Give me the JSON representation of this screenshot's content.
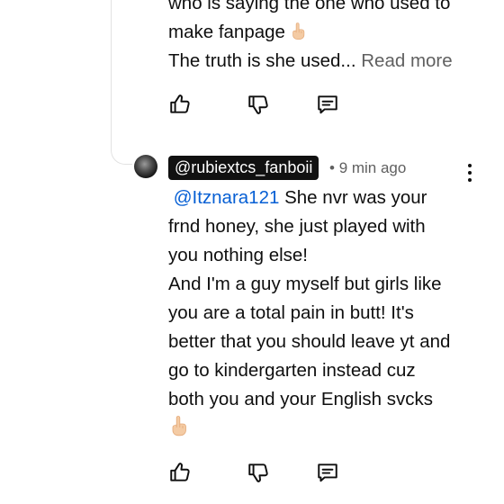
{
  "previous_comment": {
    "lines": [
      "who is saying the one who used to",
      "make fanpage",
      "The truth is she used..."
    ],
    "read_more": "Read more",
    "actions": [
      "like",
      "dislike",
      "reply"
    ]
  },
  "reply": {
    "handle": "@rubiextcs_fanboii",
    "separator": "•",
    "time": "9 min ago",
    "mention": "@Itznara121",
    "first_line_rest": " She nvr was your",
    "lines": [
      "frnd honey, she just played with",
      "you nothing else!",
      "And I'm a guy myself but girls like",
      "you are a total pain in butt! It's",
      "better that you should leave yt and",
      "go to kindergarten instead cuz",
      "both you and your English svcks"
    ],
    "actions": [
      "like",
      "dislike",
      "reply"
    ]
  },
  "icons": {
    "finger_emoji": "middle-finger-emoji",
    "like": "thumbs-up-icon",
    "dislike": "thumbs-down-icon",
    "reply": "comment-reply-icon",
    "more": "more-vert-icon"
  },
  "colors": {
    "text": "#0f0f0f",
    "secondary": "#606060",
    "link": "#065fd4",
    "chip_bg": "#111111",
    "chip_text": "#ffffff"
  }
}
